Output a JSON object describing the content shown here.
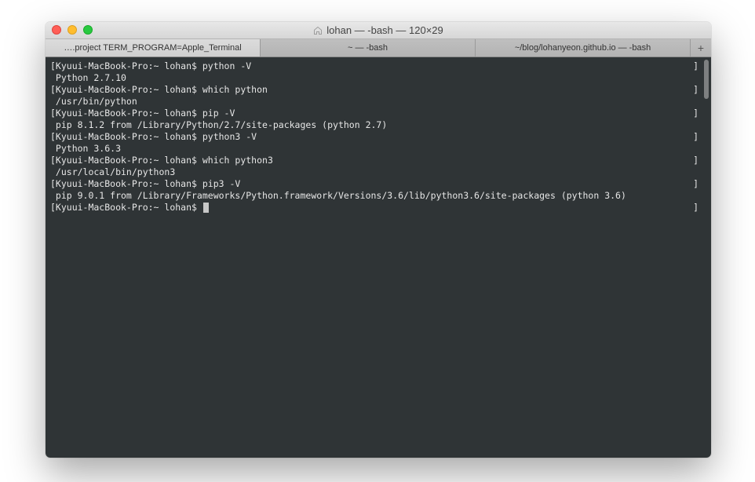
{
  "window": {
    "title": "lohan — -bash — 120×29"
  },
  "tabs": [
    {
      "label": "….project TERM_PROGRAM=Apple_Terminal",
      "active": true
    },
    {
      "label": "~ — -bash",
      "active": false
    },
    {
      "label": "~/blog/lohanyeon.github.io — -bash",
      "active": false
    }
  ],
  "tab_add_label": "+",
  "terminal": {
    "prompt_host": "Kyuui-MacBook-Pro:",
    "prompt_dir": "~",
    "prompt_user": "lohan$",
    "lines": [
      {
        "type": "cmd",
        "text": "python -V"
      },
      {
        "type": "out",
        "text": " Python 2.7.10"
      },
      {
        "type": "cmd",
        "text": "which python"
      },
      {
        "type": "out",
        "text": " /usr/bin/python"
      },
      {
        "type": "cmd",
        "text": "pip -V"
      },
      {
        "type": "out",
        "text": " pip 8.1.2 from /Library/Python/2.7/site-packages (python 2.7)"
      },
      {
        "type": "cmd",
        "text": "python3 -V"
      },
      {
        "type": "out",
        "text": " Python 3.6.3"
      },
      {
        "type": "cmd",
        "text": "which python3"
      },
      {
        "type": "out",
        "text": " /usr/local/bin/python3"
      },
      {
        "type": "cmd",
        "text": "pip3 -V"
      },
      {
        "type": "out",
        "text": " pip 9.0.1 from /Library/Frameworks/Python.framework/Versions/3.6/lib/python3.6/site-packages (python 3.6)"
      },
      {
        "type": "cmd",
        "text": "",
        "cursor": true
      }
    ]
  }
}
